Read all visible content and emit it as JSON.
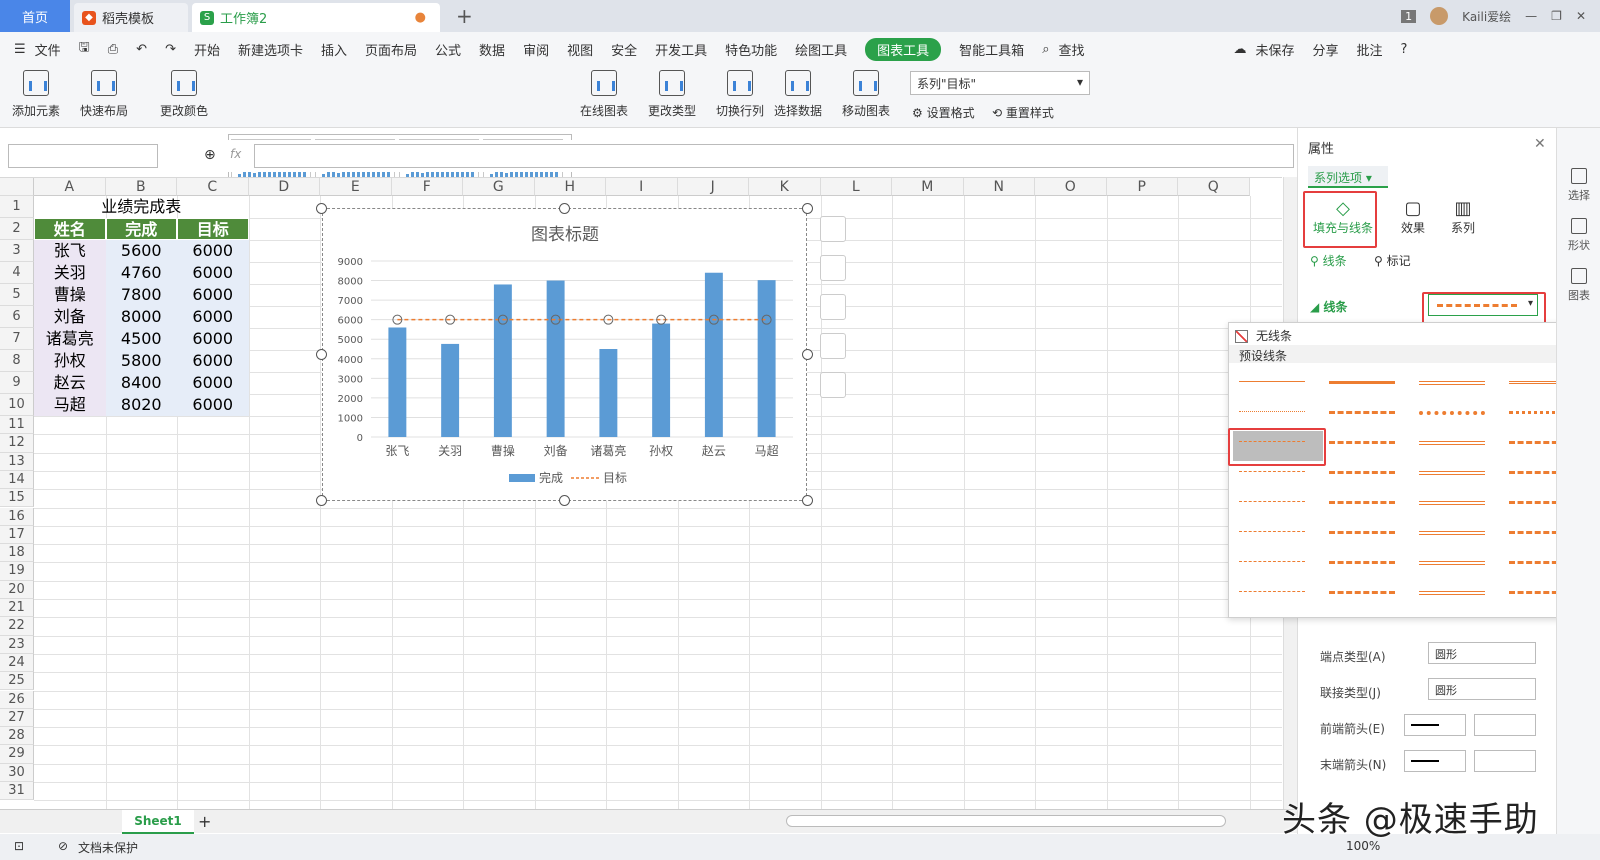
{
  "tabs": {
    "home": "首页",
    "template": "稻壳模板",
    "workbook": "工作簿2",
    "add": "+"
  },
  "titlebar": {
    "badge": "1",
    "user": "Kaili爱绘"
  },
  "menu": [
    "文件",
    "开始",
    "新建选项卡",
    "插入",
    "页面布局",
    "公式",
    "数据",
    "审阅",
    "视图",
    "安全",
    "开发工具",
    "特色功能",
    "绘图工具",
    "图表工具",
    "智能工具箱",
    "查找"
  ],
  "menu_right": {
    "save": "未保存",
    "share": "分享",
    "comment": "批注",
    "help": "?"
  },
  "ribbon": {
    "add_element": "添加元素",
    "quick_layout": "快速布局",
    "change_color": "更改颜色",
    "online_chart": "在线图表",
    "change_type": "更改类型",
    "switch_rowcol": "切换行列",
    "select_data": "选择数据",
    "move_chart": "移动图表",
    "series_select": "系列\"目标\"",
    "set_format": "设置格式",
    "reset_style": "重置样式"
  },
  "formula": {
    "fx": "fx"
  },
  "columns": [
    "A",
    "B",
    "C",
    "D",
    "E",
    "F",
    "G",
    "H",
    "I",
    "J",
    "K",
    "L",
    "M",
    "N",
    "O",
    "P",
    "Q"
  ],
  "rows": [
    "1",
    "2",
    "3",
    "4",
    "5",
    "6",
    "7",
    "8",
    "9",
    "10",
    "11",
    "12",
    "13",
    "14",
    "15",
    "16",
    "17",
    "18",
    "19",
    "20",
    "21",
    "22",
    "23",
    "24",
    "25",
    "26",
    "27",
    "28",
    "29",
    "30",
    "31"
  ],
  "table": {
    "title": "业绩完成表",
    "headers": [
      "姓名",
      "完成",
      "目标"
    ],
    "rows": [
      [
        "张飞",
        "5600",
        "6000"
      ],
      [
        "关羽",
        "4760",
        "6000"
      ],
      [
        "曹操",
        "7800",
        "6000"
      ],
      [
        "刘备",
        "8000",
        "6000"
      ],
      [
        "诸葛亮",
        "4500",
        "6000"
      ],
      [
        "孙权",
        "5800",
        "6000"
      ],
      [
        "赵云",
        "8400",
        "6000"
      ],
      [
        "马超",
        "8020",
        "6000"
      ]
    ]
  },
  "chart_data": {
    "type": "bar",
    "title": "图表标题",
    "categories": [
      "张飞",
      "关羽",
      "曹操",
      "刘备",
      "诸葛亮",
      "孙权",
      "赵云",
      "马超"
    ],
    "series": [
      {
        "name": "完成",
        "type": "bar",
        "values": [
          5600,
          4760,
          7800,
          8000,
          4500,
          5800,
          8400,
          8020
        ],
        "color": "#5b9bd5"
      },
      {
        "name": "目标",
        "type": "line",
        "style": "dashed",
        "values": [
          6000,
          6000,
          6000,
          6000,
          6000,
          6000,
          6000,
          6000
        ],
        "color": "#ed7d31"
      }
    ],
    "yticks": [
      "0",
      "1000",
      "2000",
      "3000",
      "4000",
      "5000",
      "6000",
      "7000",
      "8000",
      "9000"
    ],
    "ylim": [
      0,
      9000
    ],
    "grid": true,
    "legend": "bottom"
  },
  "sheet": {
    "name": "Sheet1",
    "add": "+"
  },
  "status": {
    "protect": "文档未保护",
    "zoom": "100%"
  },
  "panel": {
    "title": "属性",
    "series_options": "系列选项",
    "tab_fill": "填充与线条",
    "tab_effect": "效果",
    "tab_series": "系列",
    "sub_line": "线条",
    "sub_marker": "标记",
    "line_section": "线条",
    "dropdown_none": "无线条",
    "dropdown_preset": "预设线条",
    "cap_type_label": "端点类型(A)",
    "cap_type_value": "圆形",
    "join_type_label": "联接类型(J)",
    "join_type_value": "圆形",
    "front_arrow_label": "前端箭头(E)",
    "end_arrow_label": "末端箭头(N)"
  },
  "rail": {
    "select": "选择",
    "shape": "形状",
    "chart": "图表"
  },
  "watermark": "头条 @极速手助",
  "colors": {
    "accent": "#2ba14a",
    "highlight": "#e53e3e",
    "bar": "#5b9bd5",
    "line": "#ed7d31",
    "header_green": "#4f8b3a"
  }
}
